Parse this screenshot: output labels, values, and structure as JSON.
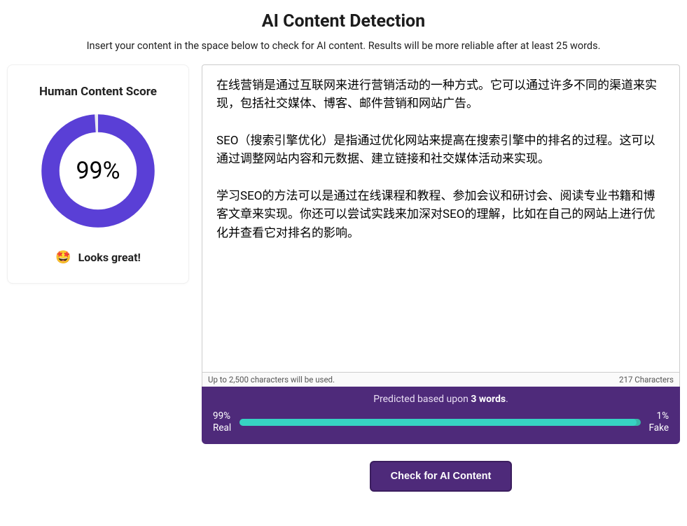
{
  "header": {
    "title": "AI Content Detection",
    "subtitle": "Insert your content in the space below to check for AI content. Results will be more reliable after at least 25 words."
  },
  "sidebar": {
    "score_title": "Human Content Score",
    "score_value": "99%",
    "score_percent": 99,
    "status_emoji": "🤩",
    "status_label": "Looks great!"
  },
  "main": {
    "content_text": "在线营销是通过互联网来进行营销活动的一种方式。它可以通过许多不同的渠道来实现，包括社交媒体、博客、邮件营销和网站广告。\n\nSEO（搜索引擎优化）是指通过优化网站来提高在搜索引擎中的排名的过程。这可以通过调整网站内容和元数据、建立链接和社交媒体活动来实现。\n\n学习SEO的方法可以是通过在线课程和教程、参加会议和研讨会、阅读专业书籍和博客文章来实现。你还可以尝试实践来加深对SEO的理解，比如在自己的网站上进行优化并查看它对排名的影响。",
    "char_limit_note": "Up to 2,500 characters will be used.",
    "char_count": "217 Characters"
  },
  "prediction": {
    "prefix": "Predicted based upon ",
    "word_count": "3 words",
    "suffix": ".",
    "real_pct": "99%",
    "real_label": "Real",
    "fake_pct": "1%",
    "fake_label": "Fake",
    "bar_fill_percent": 99
  },
  "cta": {
    "label": "Check for AI Content"
  },
  "colors": {
    "accent_purple": "#5a3fd6",
    "box_purple": "#4e2a7a",
    "teal": "#37d3c2"
  }
}
